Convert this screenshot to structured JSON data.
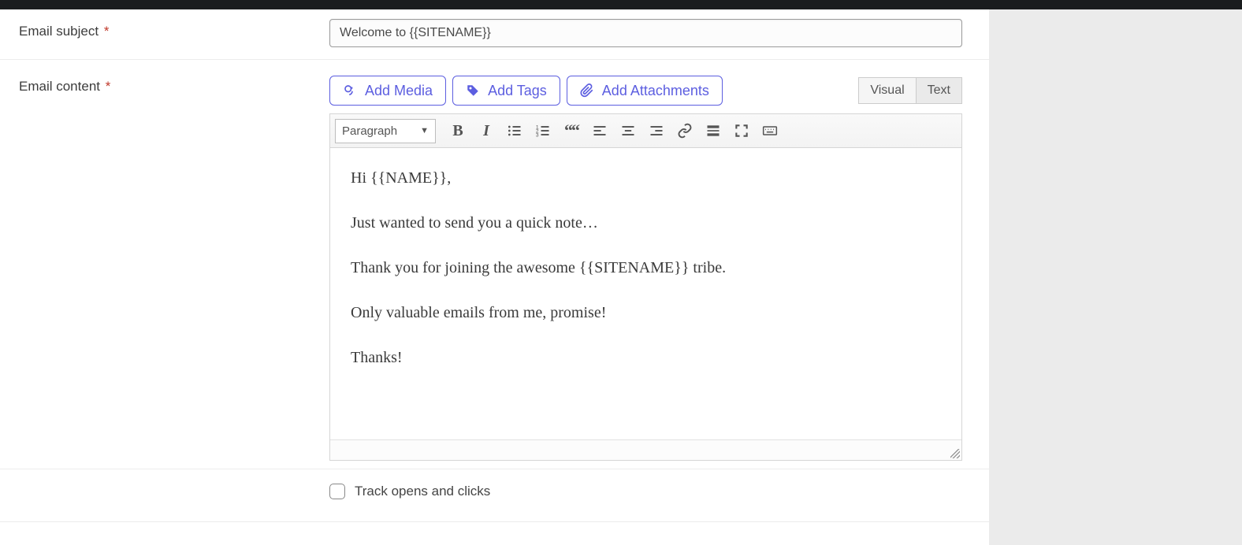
{
  "labels": {
    "email_subject": "Email subject",
    "email_content": "Email content"
  },
  "subject": {
    "value": "Welcome to {{SITENAME}}"
  },
  "insert": {
    "add_media": "Add Media",
    "add_tags": "Add Tags",
    "add_attachments": "Add Attachments"
  },
  "mode_tabs": {
    "visual": "Visual",
    "text": "Text"
  },
  "format_select": "Paragraph",
  "editor_body": {
    "p1": "Hi {{NAME}},",
    "p2": "Just wanted to send you a quick note…",
    "p3": "Thank you for joining the awesome {{SITENAME}} tribe.",
    "p4": "Only valuable emails from me, promise!",
    "p5": "Thanks!"
  },
  "track": {
    "label": "Track opens and clicks"
  },
  "colors": {
    "accent": "#5c5ee0"
  }
}
